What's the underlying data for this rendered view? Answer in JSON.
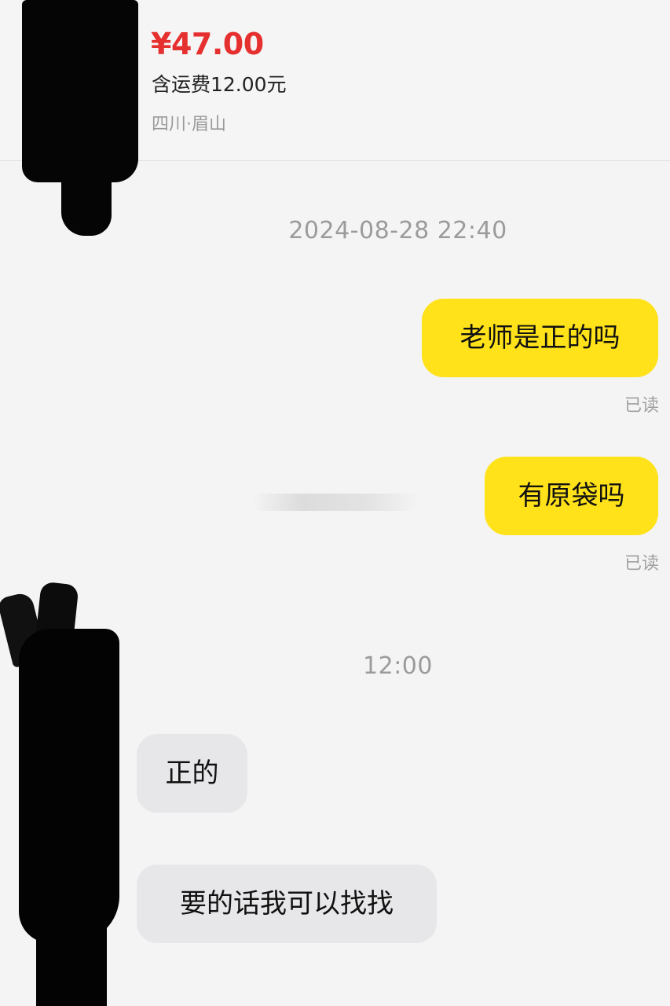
{
  "product": {
    "price": "¥47.00",
    "shipping": "含运费12.00元",
    "location": "四川·眉山"
  },
  "timestamps": {
    "first": "2024-08-28 22:40",
    "second": "12:00"
  },
  "messages": {
    "out": [
      {
        "text": "老师是正的吗",
        "status": "已读"
      },
      {
        "text": "有原袋吗",
        "status": "已读"
      }
    ],
    "in": [
      {
        "text": "正的"
      },
      {
        "text": "要的话我可以找找"
      }
    ]
  },
  "colors": {
    "price_red": "#e5302f",
    "outgoing_bubble": "#ffe21a",
    "incoming_bubble": "#e7e7e9",
    "background": "#f4f4f4"
  }
}
